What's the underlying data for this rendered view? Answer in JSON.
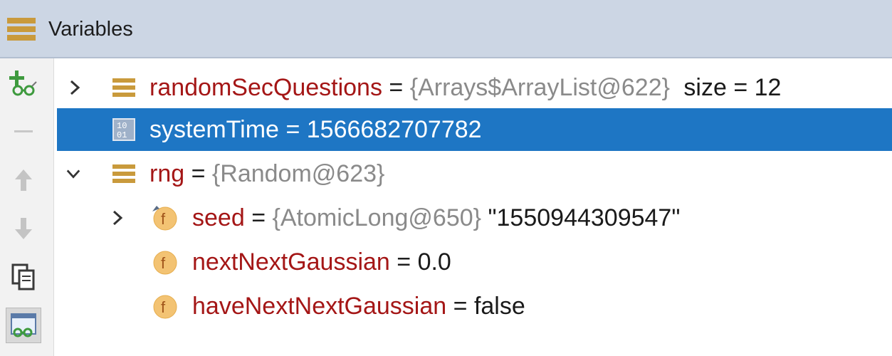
{
  "panel": {
    "title": "Variables",
    "icon": "stack-icon"
  },
  "toolbar": {
    "buttons": [
      {
        "name": "new-watch-button",
        "icon": "plus-glasses-icon"
      },
      {
        "name": "remove-watch-button",
        "icon": "minus-icon"
      },
      {
        "name": "move-up-button",
        "icon": "arrow-up-icon"
      },
      {
        "name": "move-down-button",
        "icon": "arrow-down-icon"
      },
      {
        "name": "copy-button",
        "icon": "copy-icon"
      },
      {
        "name": "watches-toggle-button",
        "icon": "watches-icon"
      }
    ]
  },
  "variables": [
    {
      "name": "randomSecQuestions",
      "eq": "=",
      "type": "{Arrays$ArrayList@622}",
      "extra": "size = 12",
      "icon": "array-icon",
      "expanded": false,
      "selected": false
    },
    {
      "name": "systemTime",
      "eq": "=",
      "value": "1566682707782",
      "icon": "primitive-icon",
      "selected": true
    },
    {
      "name": "rng",
      "eq": "=",
      "type": "{Random@623}",
      "icon": "object-icon",
      "expanded": true,
      "selected": false
    },
    {
      "name": "seed",
      "eq": "=",
      "type": "{AtomicLong@650}",
      "value": "\"1550944309547\"",
      "icon": "field-icon",
      "expanded": false
    },
    {
      "name": "nextNextGaussian",
      "eq": "=",
      "value": "0.0",
      "icon": "field-icon"
    },
    {
      "name": "haveNextNextGaussian",
      "eq": "=",
      "value": "false",
      "icon": "field-icon"
    }
  ],
  "colors": {
    "header_bg": "#ccd6e4",
    "selection": "#1e76c4",
    "name": "#a41616",
    "type": "#8a8a8a"
  }
}
